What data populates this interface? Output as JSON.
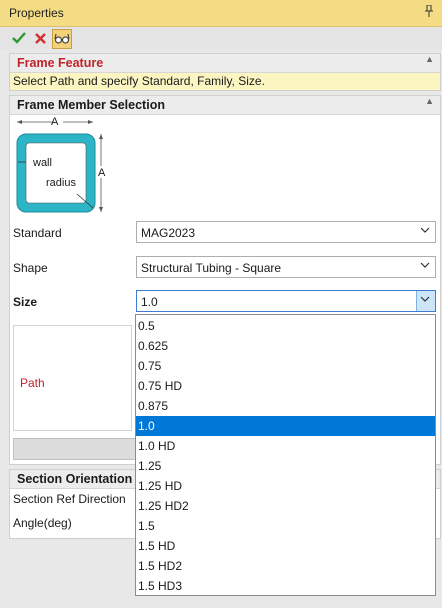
{
  "window": {
    "title": "Properties",
    "pin_glyph": "📌"
  },
  "toolbar": {
    "ok_icon": "checkmark-icon",
    "cancel_icon": "x-icon",
    "preview_icon": "glasses-icon"
  },
  "feature_panel": {
    "title": "Frame Feature",
    "message": "Select Path and specify Standard, Family, Size."
  },
  "member_panel": {
    "title": "Frame Member Selection",
    "diagram": {
      "dim_a": "A",
      "wall": "wall",
      "radius": "radius"
    },
    "standard": {
      "label": "Standard",
      "value": "MAG2023"
    },
    "shape": {
      "label": "Shape",
      "value": "Structural Tubing - Square"
    },
    "size": {
      "label": "Size",
      "value": "1.0"
    },
    "path_label": "Path"
  },
  "orientation_panel": {
    "title": "Section Orientation",
    "ref_direction_label": "Section Ref Direction",
    "angle_label": "Angle(deg)"
  },
  "size_dropdown": {
    "options": [
      "0.5",
      "0.625",
      "0.75",
      "0.75 HD",
      "0.875",
      "1.0",
      "1.0 HD",
      "1.25",
      "1.25 HD",
      "1.25 HD2",
      "1.5",
      "1.5 HD",
      "1.5 HD2",
      "1.5 HD3"
    ],
    "selected": "1.0"
  },
  "colors": {
    "title_bar": "#f3dc83",
    "accent_red": "#c0232a",
    "selection_blue": "#0078d7",
    "tube_teal": "#2bb5c7"
  }
}
